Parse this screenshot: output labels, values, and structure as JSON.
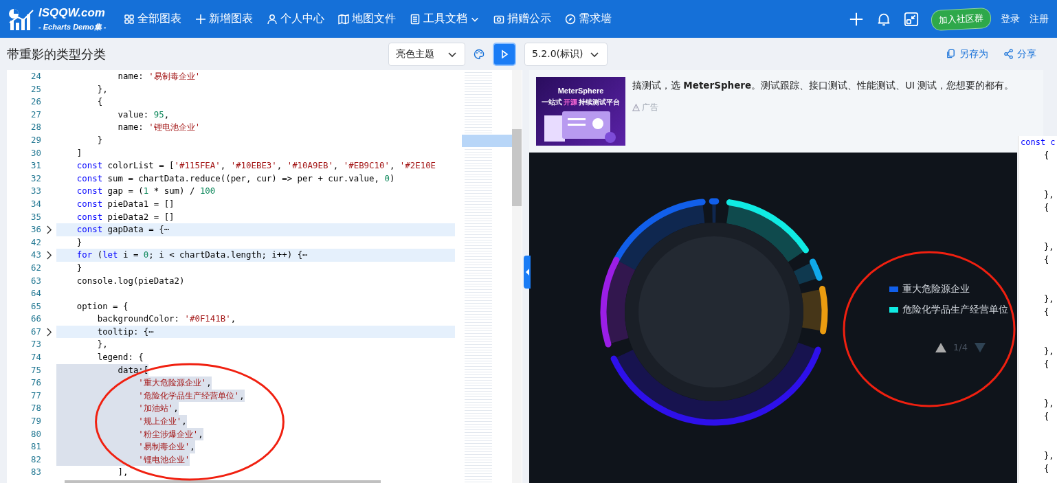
{
  "header": {
    "logo_title": "ISQQW.com",
    "logo_subtitle": "- Echarts Demo集 -",
    "nav": [
      {
        "label": "全部图表",
        "kind": "grid",
        "dropdown": false
      },
      {
        "label": "新增图表",
        "kind": "plus",
        "dropdown": false
      },
      {
        "label": "个人中心",
        "kind": "user",
        "dropdown": false
      },
      {
        "label": "地图文件",
        "kind": "map",
        "dropdown": false
      },
      {
        "label": "工具文档",
        "kind": "doc",
        "dropdown": true
      },
      {
        "label": "捐赠公示",
        "kind": "camera",
        "dropdown": false
      },
      {
        "label": "需求墙",
        "kind": "compass",
        "dropdown": false
      }
    ],
    "community_button": "加入社区群",
    "login": "登录",
    "register": "注册"
  },
  "toolbar": {
    "title": "带重影的类型分类",
    "theme_select": "亮色主题",
    "version_select": "5.2.0(标识)",
    "save_as": "另存为",
    "share": "分享"
  },
  "editor": {
    "lines": [
      {
        "num": "24",
        "folded": false,
        "selected": false,
        "tokens": [
          {
            "kind": "txt",
            "text": "            name: "
          },
          {
            "kind": "str",
            "text": "'易制毒企业'"
          }
        ]
      },
      {
        "num": "25",
        "folded": false,
        "selected": false,
        "tokens": [
          {
            "kind": "txt",
            "text": "        },"
          }
        ]
      },
      {
        "num": "26",
        "folded": false,
        "selected": false,
        "tokens": [
          {
            "kind": "txt",
            "text": "        {"
          }
        ]
      },
      {
        "num": "27",
        "folded": false,
        "selected": false,
        "tokens": [
          {
            "kind": "txt",
            "text": "            value: "
          },
          {
            "kind": "num",
            "text": "95"
          },
          {
            "kind": "txt",
            "text": ","
          }
        ]
      },
      {
        "num": "28",
        "folded": false,
        "selected": false,
        "tokens": [
          {
            "kind": "txt",
            "text": "            name: "
          },
          {
            "kind": "str",
            "text": "'锂电池企业'"
          }
        ]
      },
      {
        "num": "29",
        "folded": false,
        "selected": false,
        "tokens": [
          {
            "kind": "txt",
            "text": "        }"
          }
        ]
      },
      {
        "num": "30",
        "folded": false,
        "selected": false,
        "tokens": [
          {
            "kind": "txt",
            "text": "    ]"
          }
        ]
      },
      {
        "num": "31",
        "folded": false,
        "selected": false,
        "tokens": [
          {
            "kind": "kw",
            "text": "    const"
          },
          {
            "kind": "txt",
            "text": " colorList = ["
          },
          {
            "kind": "str",
            "text": "'#115FEA'"
          },
          {
            "kind": "txt",
            "text": ", "
          },
          {
            "kind": "str",
            "text": "'#10EBE3'"
          },
          {
            "kind": "txt",
            "text": ", "
          },
          {
            "kind": "str",
            "text": "'#10A9EB'"
          },
          {
            "kind": "txt",
            "text": ", "
          },
          {
            "kind": "str",
            "text": "'#EB9C10'"
          },
          {
            "kind": "txt",
            "text": ", "
          },
          {
            "kind": "str",
            "text": "'#2E10E"
          }
        ]
      },
      {
        "num": "32",
        "folded": false,
        "selected": false,
        "tokens": [
          {
            "kind": "kw",
            "text": "    const"
          },
          {
            "kind": "txt",
            "text": " sum = chartData.reduce((per, cur) => per + cur.value, "
          },
          {
            "kind": "num",
            "text": "0"
          },
          {
            "kind": "txt",
            "text": ")"
          }
        ]
      },
      {
        "num": "33",
        "folded": false,
        "selected": false,
        "tokens": [
          {
            "kind": "kw",
            "text": "    const"
          },
          {
            "kind": "txt",
            "text": " gap = ("
          },
          {
            "kind": "num",
            "text": "1"
          },
          {
            "kind": "txt",
            "text": " * sum) / "
          },
          {
            "kind": "num",
            "text": "100"
          }
        ]
      },
      {
        "num": "34",
        "folded": false,
        "selected": false,
        "tokens": [
          {
            "kind": "kw",
            "text": "    const"
          },
          {
            "kind": "txt",
            "text": " pieData1 = []"
          }
        ]
      },
      {
        "num": "35",
        "folded": false,
        "selected": false,
        "tokens": [
          {
            "kind": "kw",
            "text": "    const"
          },
          {
            "kind": "txt",
            "text": " pieData2 = []"
          }
        ]
      },
      {
        "num": "36",
        "folded": true,
        "selected": false,
        "tokens": [
          {
            "kind": "kw",
            "text": "    const"
          },
          {
            "kind": "txt",
            "text": " gapData = {⋯"
          }
        ]
      },
      {
        "num": "42",
        "folded": false,
        "selected": false,
        "tokens": [
          {
            "kind": "txt",
            "text": "    }"
          }
        ]
      },
      {
        "num": "43",
        "folded": true,
        "selected": false,
        "tokens": [
          {
            "kind": "kw",
            "text": "    for"
          },
          {
            "kind": "txt",
            "text": " ("
          },
          {
            "kind": "kw",
            "text": "let"
          },
          {
            "kind": "txt",
            "text": " i = "
          },
          {
            "kind": "num",
            "text": "0"
          },
          {
            "kind": "txt",
            "text": "; i < chartData.length; i++) {⋯"
          }
        ]
      },
      {
        "num": "62",
        "folded": false,
        "selected": false,
        "tokens": [
          {
            "kind": "txt",
            "text": "    }"
          }
        ]
      },
      {
        "num": "63",
        "folded": false,
        "selected": false,
        "tokens": [
          {
            "kind": "txt",
            "text": "    console.log(pieData2)"
          }
        ]
      },
      {
        "num": "64",
        "folded": false,
        "selected": false
      },
      {
        "num": "65",
        "folded": false,
        "selected": false,
        "tokens": [
          {
            "kind": "txt",
            "text": "    option = {"
          }
        ]
      },
      {
        "num": "66",
        "folded": false,
        "selected": false,
        "tokens": [
          {
            "kind": "txt",
            "text": "        backgroundColor: "
          },
          {
            "kind": "str",
            "text": "'#0F141B'"
          },
          {
            "kind": "txt",
            "text": ","
          }
        ]
      },
      {
        "num": "67",
        "folded": true,
        "selected": false,
        "tokens": [
          {
            "kind": "txt",
            "text": "        tooltip: {⋯"
          }
        ]
      },
      {
        "num": "73",
        "folded": false,
        "selected": false,
        "tokens": [
          {
            "kind": "txt",
            "text": "        },"
          }
        ]
      },
      {
        "num": "74",
        "folded": false,
        "selected": false,
        "tokens": [
          {
            "kind": "txt",
            "text": "        legend: {"
          }
        ]
      },
      {
        "num": "75",
        "folded": false,
        "selected": true,
        "tokens": [
          {
            "kind": "txt",
            "text": "            data:["
          }
        ]
      },
      {
        "num": "76",
        "folded": false,
        "selected": true,
        "tokens": [
          {
            "kind": "str",
            "text": "                '重大危险源企业'"
          },
          {
            "kind": "txt",
            "text": ","
          }
        ]
      },
      {
        "num": "77",
        "folded": false,
        "selected": true,
        "tokens": [
          {
            "kind": "str",
            "text": "                '危险化学品生产经营单位'"
          },
          {
            "kind": "txt",
            "text": ","
          }
        ]
      },
      {
        "num": "78",
        "folded": false,
        "selected": true,
        "tokens": [
          {
            "kind": "str",
            "text": "                '加油站'"
          },
          {
            "kind": "txt",
            "text": ","
          }
        ]
      },
      {
        "num": "79",
        "folded": false,
        "selected": true,
        "tokens": [
          {
            "kind": "str",
            "text": "                '规上企业'"
          },
          {
            "kind": "txt",
            "text": ","
          }
        ]
      },
      {
        "num": "80",
        "folded": false,
        "selected": true,
        "tokens": [
          {
            "kind": "str",
            "text": "                '粉尘涉爆企业'"
          },
          {
            "kind": "txt",
            "text": ","
          }
        ]
      },
      {
        "num": "81",
        "folded": false,
        "selected": true,
        "tokens": [
          {
            "kind": "str",
            "text": "                '易制毒企业'"
          },
          {
            "kind": "txt",
            "text": ","
          }
        ]
      },
      {
        "num": "82",
        "folded": false,
        "selected": true,
        "tokens": [
          {
            "kind": "str",
            "text": "                '锂电池企业'"
          }
        ]
      },
      {
        "num": "83",
        "folded": false,
        "selected": false,
        "tokens": [
          {
            "kind": "txt",
            "text": "            ],"
          }
        ]
      }
    ],
    "side_lines": [
      {
        "kind": "head",
        "text": "const c"
      },
      {
        "kind": "open",
        "text": "{"
      },
      {
        "kind": "close",
        "text": "},"
      },
      {
        "kind": "open",
        "text": "{"
      },
      {
        "kind": "close",
        "text": "},"
      },
      {
        "kind": "open",
        "text": "{"
      },
      {
        "kind": "close",
        "text": "},"
      },
      {
        "kind": "open",
        "text": "{"
      },
      {
        "kind": "close",
        "text": "},"
      },
      {
        "kind": "open",
        "text": "{"
      },
      {
        "kind": "close",
        "text": "},"
      },
      {
        "kind": "open",
        "text": "{"
      },
      {
        "kind": "close",
        "text": "},"
      },
      {
        "kind": "open",
        "text": "{"
      }
    ]
  },
  "ad": {
    "banner_brand": "MeterSphere",
    "banner_slogan": [
      {
        "text": "一站式",
        "highlight": false
      },
      {
        "text": "开源",
        "highlight": true
      },
      {
        "text": "持续测试平台",
        "highlight": false
      }
    ],
    "text": "搞测试，选 **MeterSphere**。测试跟踪、接口测试、性能测试、UI 测试，您想要的都有。",
    "label": "广告"
  },
  "chart": {
    "legend": [
      {
        "label": "重大危险源企业",
        "color": "#115fea"
      },
      {
        "label": "危险化学品生产经营单位",
        "color": "#10ebe3"
      }
    ],
    "pager": "1/4"
  }
}
